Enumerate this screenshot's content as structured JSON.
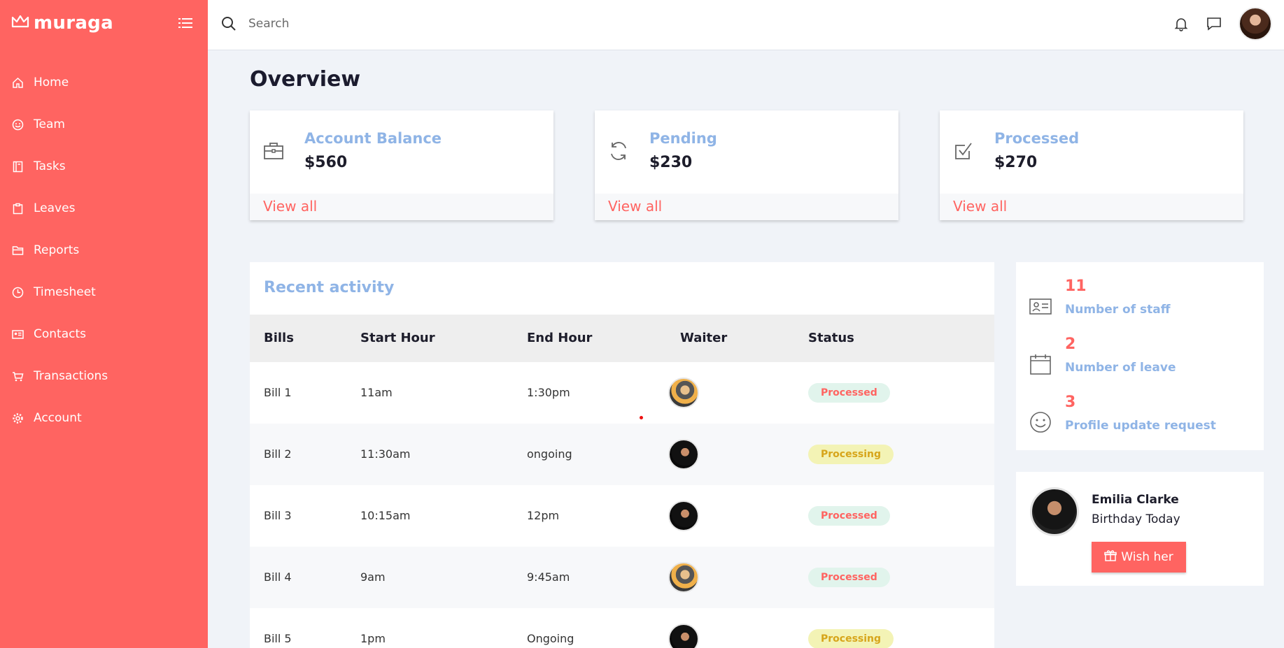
{
  "brand": {
    "name": "muraga",
    "accent": "#ff6461"
  },
  "sidebar": {
    "items": [
      {
        "label": "Home",
        "icon": "home-icon"
      },
      {
        "label": "Team",
        "icon": "smile-icon"
      },
      {
        "label": "Tasks",
        "icon": "book-icon"
      },
      {
        "label": "Leaves",
        "icon": "clipboard-icon"
      },
      {
        "label": "Reports",
        "icon": "folder-icon"
      },
      {
        "label": "Timesheet",
        "icon": "clock-icon"
      },
      {
        "label": "Contacts",
        "icon": "id-card-icon"
      },
      {
        "label": "Transactions",
        "icon": "cart-icon"
      },
      {
        "label": "Account",
        "icon": "gear-icon"
      }
    ]
  },
  "search": {
    "placeholder": "Search"
  },
  "main": {
    "title": "Overview",
    "cards": [
      {
        "label": "Account Balance",
        "value": "$560",
        "link": "View all",
        "icon": "briefcase-icon"
      },
      {
        "label": "Pending",
        "value": "$230",
        "link": "View all",
        "icon": "refresh-icon"
      },
      {
        "label": "Processed",
        "value": "$270",
        "link": "View all",
        "icon": "checkbox-icon"
      }
    ],
    "activity": {
      "title": "Recent activity",
      "columns": [
        "Bills",
        "Start Hour",
        "End Hour",
        "Waiter",
        "Status"
      ],
      "rows": [
        {
          "bill": "Bill 1",
          "start": "11am",
          "end": "1:30pm",
          "status": "Processed"
        },
        {
          "bill": "Bill 2",
          "start": "11:30am",
          "end": "ongoing",
          "status": "Processing"
        },
        {
          "bill": "Bill 3",
          "start": "10:15am",
          "end": "12pm",
          "status": "Processed"
        },
        {
          "bill": "Bill 4",
          "start": "9am",
          "end": "9:45am",
          "status": "Processed"
        },
        {
          "bill": "Bill 5",
          "start": "1pm",
          "end": "Ongoing",
          "status": "Processing"
        }
      ]
    }
  },
  "stats": [
    {
      "value": "11",
      "label": "Number of staff",
      "icon": "contact-card-icon"
    },
    {
      "value": "2",
      "label": "Number of leave",
      "icon": "calendar-icon"
    },
    {
      "value": "3",
      "label": "Profile update request",
      "icon": "smiley-icon"
    }
  ],
  "birthday": {
    "name": "Emilia Clarke",
    "text": "Birthday Today",
    "button": "Wish her"
  }
}
